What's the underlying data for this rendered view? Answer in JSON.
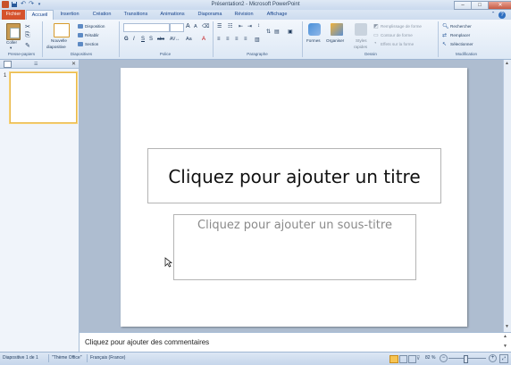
{
  "window": {
    "title": "Présentation2 - Microsoft PowerPoint",
    "controls": {
      "minimize": "–",
      "maximize": "□",
      "close": "✕"
    }
  },
  "quick_access": {
    "save_icon": "save-icon",
    "undo_icon": "undo-icon",
    "redo_icon": "redo-icon"
  },
  "tabs": [
    "Fichier",
    "Accueil",
    "Insertion",
    "Création",
    "Transitions",
    "Animations",
    "Diaporama",
    "Révision",
    "Affichage"
  ],
  "active_tab": "Accueil",
  "ribbon": {
    "clipboard": {
      "paste": "Coller",
      "group_label": "Presse-papiers"
    },
    "slides": {
      "new_slide_line1": "Nouvelle",
      "new_slide_line2": "diapositive",
      "layout": "Disposition",
      "reset": "Rétablir",
      "section": "Section",
      "group_label": "Diapositives"
    },
    "font": {
      "bold": "G",
      "italic": "I",
      "underline": "S",
      "strike": "S",
      "abc": "abc",
      "grow": "A",
      "shrink": "A",
      "case": "Aa",
      "color": "A",
      "group_label": "Police"
    },
    "paragraph": {
      "group_label": "Paragraphe"
    },
    "drawing": {
      "shapes": "Formes",
      "arrange": "Organiser",
      "styles_line1": "Styles",
      "styles_line2": "rapides",
      "fill": "Remplissage de forme",
      "outline": "Contour de forme",
      "effects": "Effets sur la forme",
      "group_label": "Dessin"
    },
    "editing": {
      "find": "Rechercher",
      "replace": "Remplacer",
      "select": "Sélectionner",
      "group_label": "Modification"
    }
  },
  "panel": {
    "slide_number": "1"
  },
  "slide": {
    "title_placeholder": "Cliquez pour ajouter un titre",
    "subtitle_placeholder": "Cliquez pour ajouter un sous-titre"
  },
  "notes": {
    "placeholder": "Cliquez pour ajouter des commentaires"
  },
  "status": {
    "slide_info": "Diapositive 1 de 1",
    "theme": "\"Thème Office\"",
    "language": "Français (France)",
    "zoom": "82 %"
  },
  "colors": {
    "file_tab": "#d5522c",
    "accent": "#15428b",
    "thumb_border": "#e9b94a"
  }
}
